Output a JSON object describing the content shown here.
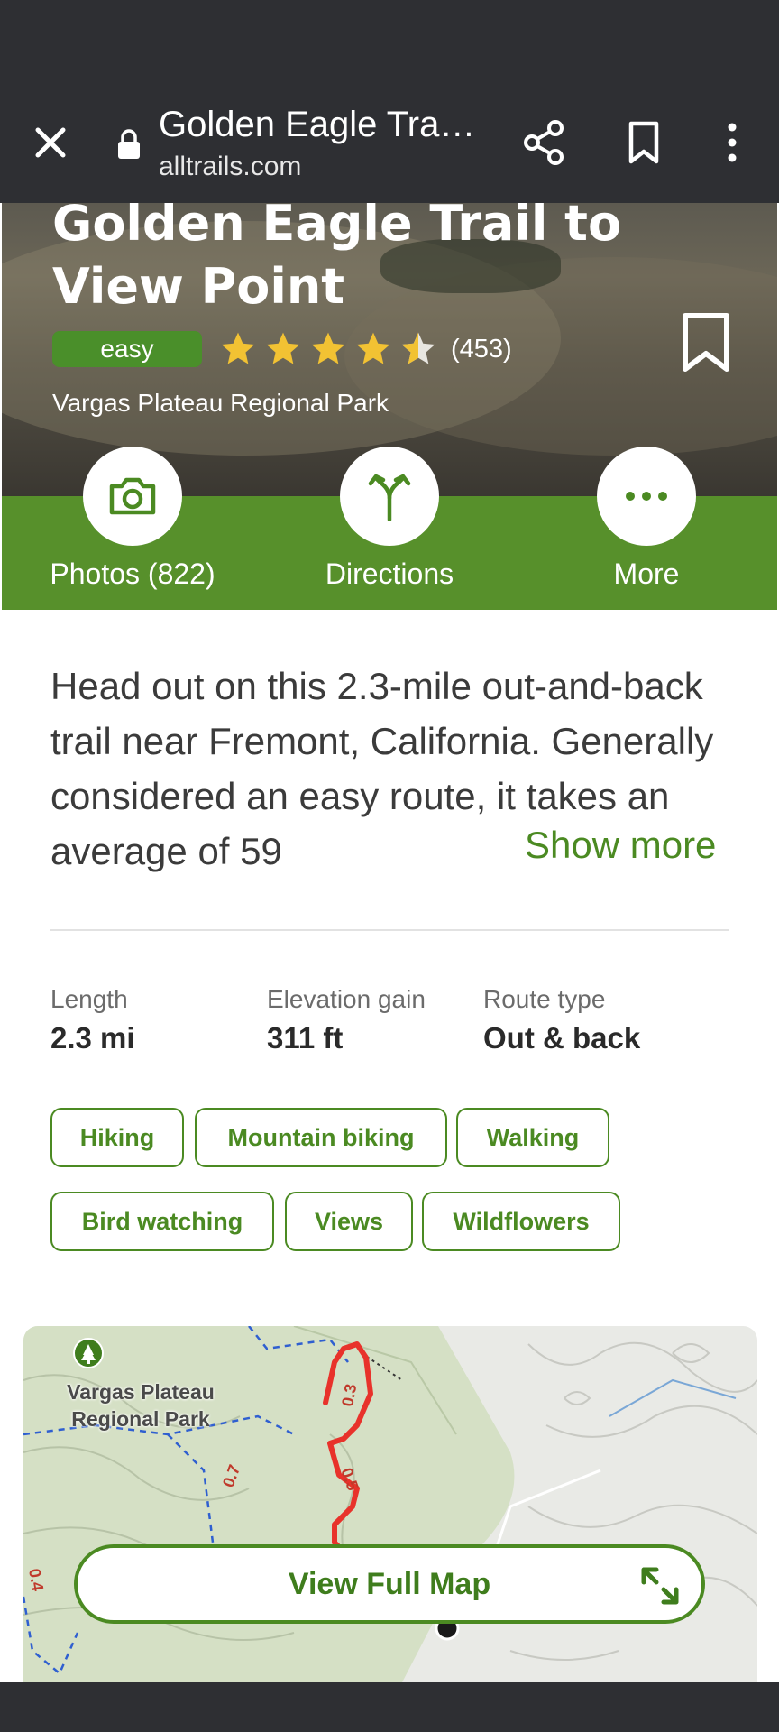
{
  "browser": {
    "title": "Golden Eagle Tra…",
    "url": "alltrails.com"
  },
  "trail": {
    "title": "Golden Eagle Trail to View Point",
    "difficulty": "easy",
    "rating": 4.5,
    "review_count": "(453)",
    "park": "Vargas Plateau Regional Park"
  },
  "actions": {
    "photos": "Photos (822)",
    "directions": "Directions",
    "more": "More"
  },
  "description": {
    "text": "Head out on this 2.3-mile out-and-back trail near Fremont, California. Generally considered an easy route, it takes an average of 59",
    "show_more": "Show more"
  },
  "stats": [
    {
      "label": "Length",
      "value": "2.3 mi"
    },
    {
      "label": "Elevation gain",
      "value": "311 ft"
    },
    {
      "label": "Route type",
      "value": "Out & back"
    }
  ],
  "tags": [
    "Hiking",
    "Mountain biking",
    "Walking",
    "Bird watching",
    "Views",
    "Wildflowers"
  ],
  "map": {
    "park_label": "Vargas Plateau Regional Park",
    "button": "View Full Map",
    "markers": [
      "0.3",
      "0.5",
      "0.7",
      "0.4"
    ]
  },
  "colors": {
    "brand_green": "#57902b",
    "chrome": "#2e2f33",
    "trail_red": "#e8322b"
  }
}
